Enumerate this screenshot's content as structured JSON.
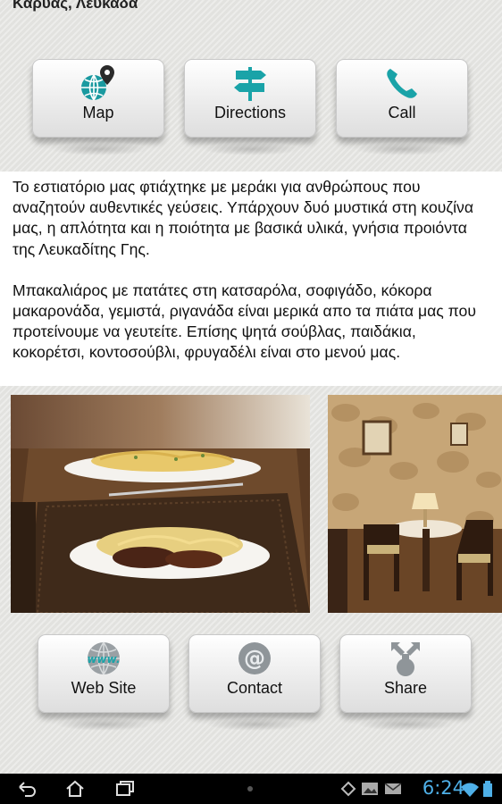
{
  "header": {
    "location": "Καρυάς, Λευκάδα"
  },
  "top_buttons": [
    {
      "label": "Map",
      "icon": "globe-pin-icon"
    },
    {
      "label": "Directions",
      "icon": "signpost-icon"
    },
    {
      "label": "Call",
      "icon": "phone-icon"
    }
  ],
  "description": {
    "paragraph1": "Το εστιατόριο μας φτιάχτηκε με μεράκι για ανθρώπους που αναζητούν αυθεντικές γεύσεις. Υπάρχουν δυό μυστικά στη κουζίνα μας, η απλότητα και η ποιότητα με βασικά υλικά, γνήσια προιόντα της Λευκαδίτης Γης.",
    "paragraph2": "Μπακαλιάρος με πατάτες στη κατσαρόλα, σοφιγάδο, κόκορα μακαρονάδα, γεμιστά, ριγανάδα είναι μερικά απο τα πιάτα μας που προτείνουμε να γευτείτε. Επίσης ψητά σούβλας, παιδάκια, κοκορέτσι, κοντοσούβλι, φρυγαδέλι είναι στο μενού μας."
  },
  "bottom_buttons": [
    {
      "label": "Web Site",
      "icon": "www-globe-icon"
    },
    {
      "label": "Contact",
      "icon": "at-sign-icon"
    },
    {
      "label": "Share",
      "icon": "share-icon"
    }
  ],
  "status_bar": {
    "time": "6:24",
    "colors": {
      "clock": "#4fb0e8",
      "accent": "#1aa3a8"
    }
  }
}
